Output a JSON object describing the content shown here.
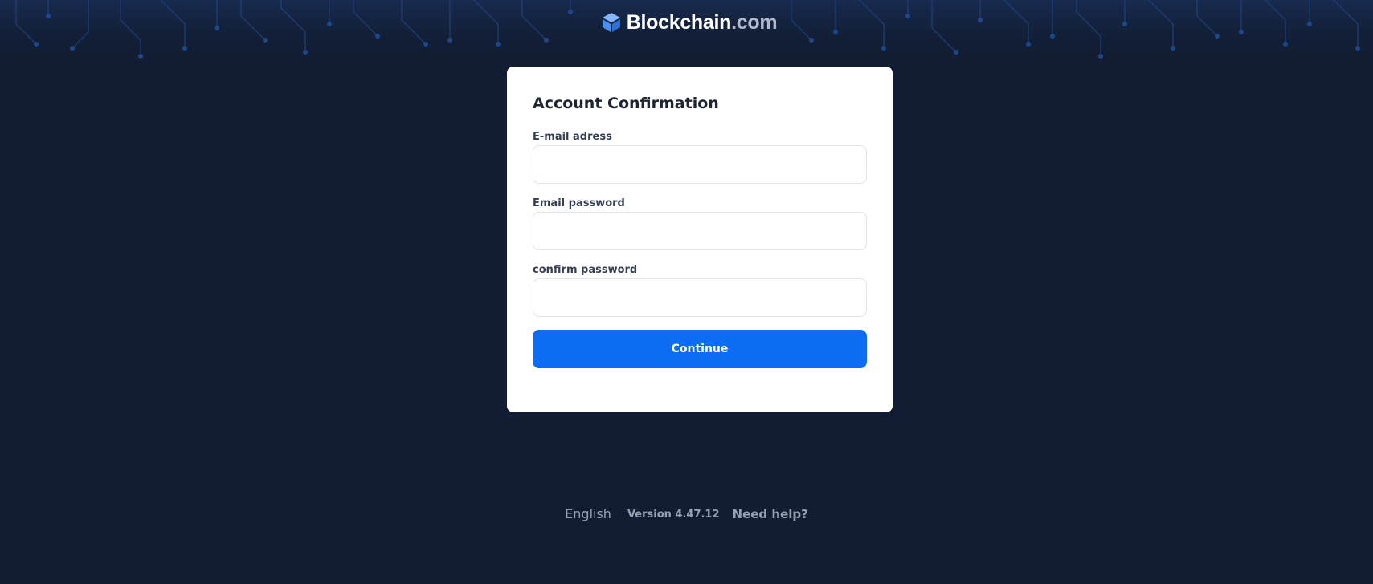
{
  "brand": {
    "name": "Blockchain",
    "tld": ".com",
    "logo_icon": "blockchain-cube-icon",
    "accent_color": "#4b90f5"
  },
  "form": {
    "title": "Account Confirmation",
    "fields": [
      {
        "label": "E-mail adress",
        "value": "",
        "placeholder": ""
      },
      {
        "label": "Email password",
        "value": "",
        "placeholder": ""
      },
      {
        "label": "confirm password",
        "value": "",
        "placeholder": ""
      }
    ],
    "submit_label": "Continue",
    "submit_color": "#0c6cf2"
  },
  "footer": {
    "language": "English",
    "version": "Version 4.47.12",
    "help": "Need help?"
  },
  "colors": {
    "background": "#121d33",
    "card": "#ffffff"
  }
}
